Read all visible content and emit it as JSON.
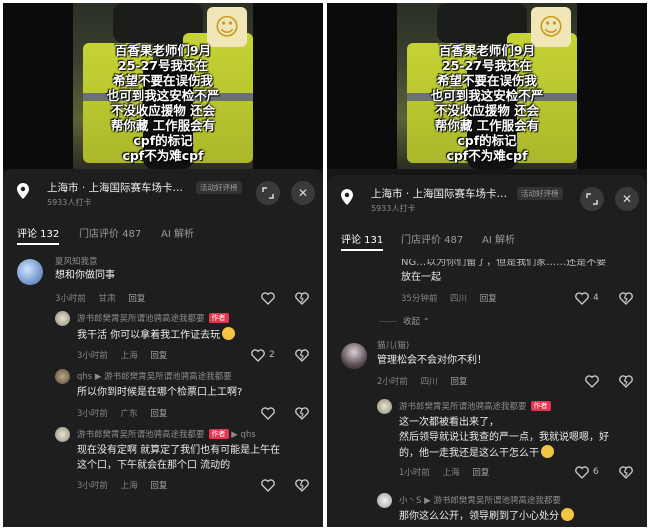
{
  "video": {
    "overlay_text": "百香果老师们9月\n25-27号我还在\n希望不要在误伤我\n也可到我这安检不严\n不没收应援物 还会\n帮你藏  工作服会有\ncpf的标记\ncpf不为难cpf"
  },
  "left": {
    "location": {
      "title": "上海市 · 上海国际赛车场卡…",
      "badge": "活动好评榜",
      "subtitle": "5933人打卡"
    },
    "tabs": [
      {
        "label": "评论 132"
      },
      {
        "label": "门店评价 487"
      },
      {
        "label": "AI 解析"
      }
    ],
    "comments": [
      {
        "user": "夏风知我意",
        "text": [
          "想和你做同事"
        ],
        "time": "3小时前",
        "place": "甘肃",
        "reply": "回复",
        "likes": ""
      },
      {
        "user": "游书郎樊霄吴所谓池骋高途我都要",
        "author_tag": "作者",
        "text": [
          "我干活    你可以拿着我工作证去玩"
        ],
        "time": "3小时前",
        "place": "上海",
        "reply": "回复",
        "likes": "2"
      },
      {
        "user": "qhs  ▶ 游书郎樊霄吴所谓池骋高途我都要",
        "text": [
          "所以你到时候是在哪个检票口上工啊?"
        ],
        "time": "3小时前",
        "place": "广东",
        "reply": "回复",
        "likes": ""
      },
      {
        "user": "游书郎樊霄吴所谓池骋高途我都要",
        "author_tag": "作者",
        "reply_to": "▶ qhs",
        "text": [
          "现在没有定啊   就算定了我们也有可能是上午在",
          "这个口，下午就会在那个口    流动的"
        ],
        "time": "3小时前",
        "place": "上海",
        "reply": "回复",
        "likes": ""
      }
    ]
  },
  "right": {
    "location": {
      "title": "上海市 · 上海国际赛车场卡…",
      "badge": "活动好评榜",
      "subtitle": "5933人打卡"
    },
    "tabs": [
      {
        "label": "评论 131"
      },
      {
        "label": "门店评价 487"
      },
      {
        "label": "AI 解析"
      }
    ],
    "partial_top": {
      "text": [
        "NG…以为你们留了，但是我们家……还是不要",
        "放在一起"
      ],
      "time": "35分钟前",
      "place": "四川",
      "reply": "回复",
      "likes": "4"
    },
    "collapse_label": "收起",
    "comments": [
      {
        "user": "猫儿(猫)",
        "text": [
          "管理松会不会对你不利！"
        ],
        "time": "2小时前",
        "place": "四川",
        "reply": "回复",
        "likes": ""
      },
      {
        "user": "游书郎樊霄吴所谓池骋高途我都要",
        "author_tag": "作者",
        "text": [
          "这一次都被看出来了，",
          "然后领导就说让我查的严一点，我就说嗯嗯，好",
          "的，他一走我还是这么干怎么干"
        ],
        "time": "1小时前",
        "place": "上海",
        "reply": "回复",
        "likes": "6"
      },
      {
        "user": "小丶S  ▶ 游书郎樊霄吴所谓池骋高途我都要",
        "text": [
          "那你这么公开，领导刷到了小心处分"
        ],
        "time": "",
        "place": "",
        "reply": "",
        "likes": ""
      }
    ]
  }
}
